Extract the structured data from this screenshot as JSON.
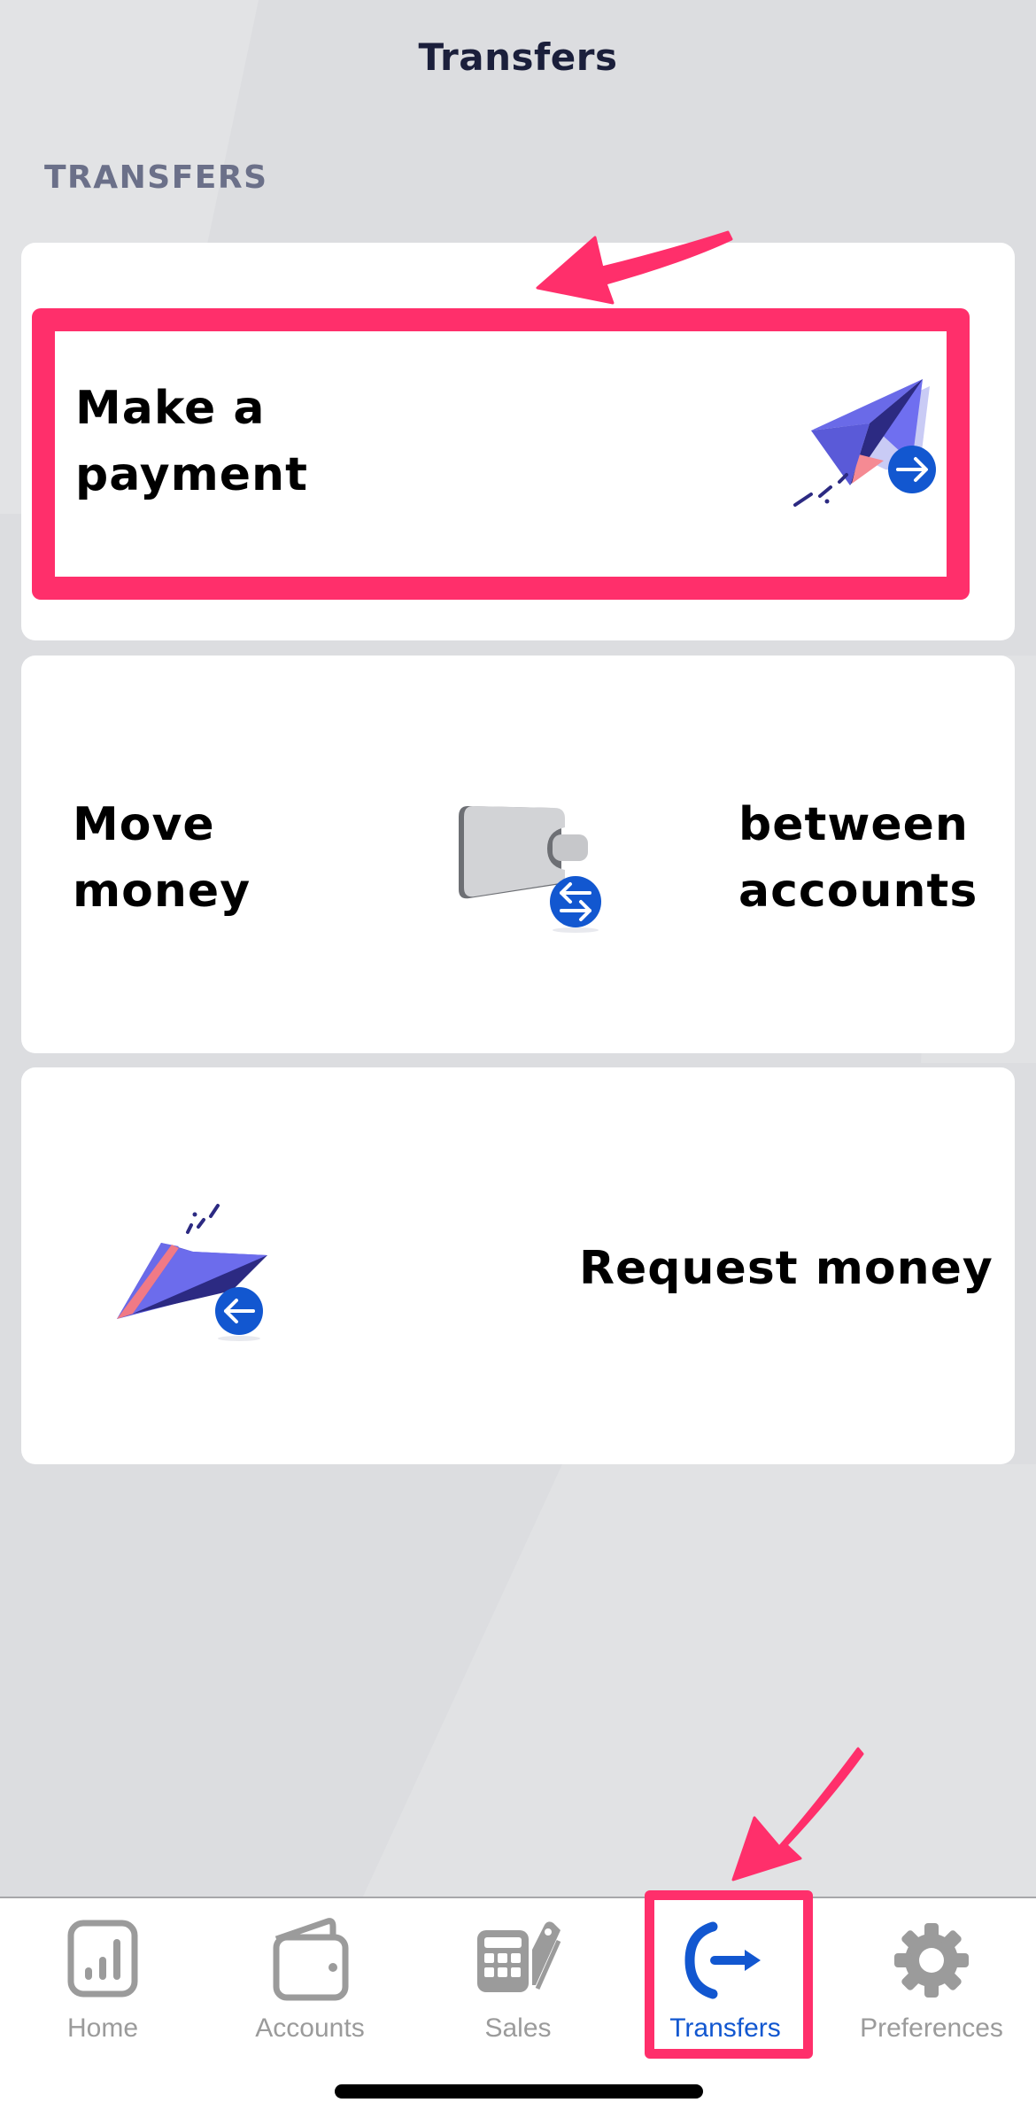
{
  "header": {
    "title": "Transfers"
  },
  "section": {
    "label": "TRANSFERS"
  },
  "cards": [
    {
      "id": "make-payment",
      "line1": "Make a",
      "line2": "payment",
      "icon": "paper-plane-send-icon",
      "highlighted": true
    },
    {
      "id": "move-money",
      "left_line1": "Move",
      "left_line2": "money",
      "right_line1": "between",
      "right_line2": "accounts",
      "icon": "wallet-transfer-icon"
    },
    {
      "id": "request-money",
      "label": "Request money",
      "icon": "paper-plane-receive-icon"
    }
  ],
  "tabbar": {
    "tabs": [
      {
        "label": "Home",
        "icon": "chart-icon",
        "active": false
      },
      {
        "label": "Accounts",
        "icon": "wallet-icon",
        "active": false
      },
      {
        "label": "Sales",
        "icon": "calculator-card-icon",
        "active": false
      },
      {
        "label": "Transfers",
        "icon": "transfer-arrow-icon",
        "active": true
      },
      {
        "label": "Preferences",
        "icon": "gear-icon",
        "active": false
      }
    ]
  },
  "colors": {
    "accent_blue": "#1257d0",
    "annotation_pink": "#ff2f6b",
    "title_navy": "#1b1f3b",
    "section_gray": "#6b7089",
    "inactive_tab": "#9b9b9b"
  }
}
